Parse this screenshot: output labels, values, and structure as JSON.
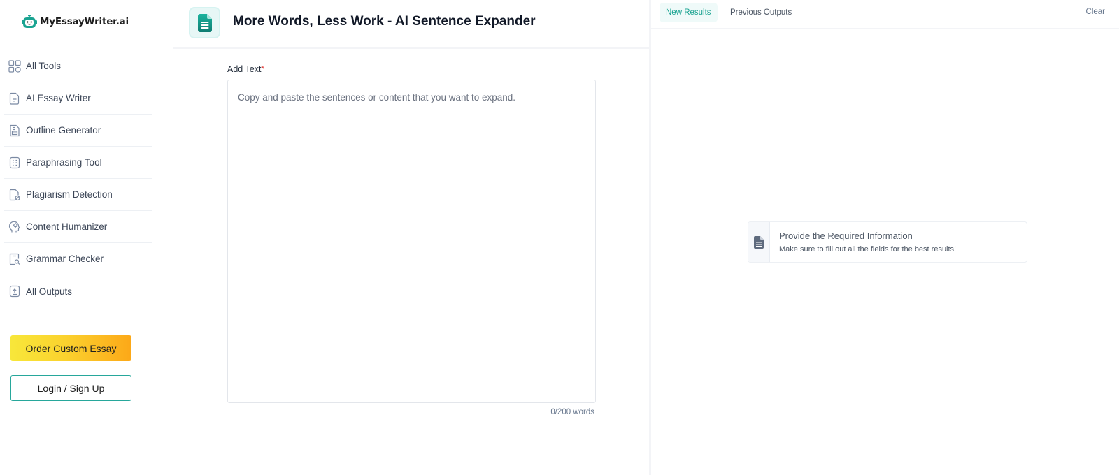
{
  "brand": {
    "name": "MyEssayWriter.ai",
    "accent": "#1aa391"
  },
  "sidebar": {
    "items": [
      {
        "label": "All Tools",
        "icon": "grid-icon"
      },
      {
        "label": "AI Essay Writer",
        "icon": "document-icon"
      },
      {
        "label": "Outline Generator",
        "icon": "outline-icon"
      },
      {
        "label": "Paraphrasing Tool",
        "icon": "paraphrase-icon"
      },
      {
        "label": "Plagiarism Detection",
        "icon": "plagiarism-icon"
      },
      {
        "label": "Content Humanizer",
        "icon": "humanizer-icon"
      },
      {
        "label": "Grammar Checker",
        "icon": "grammar-check-icon"
      },
      {
        "label": "All Outputs",
        "icon": "outputs-icon"
      }
    ],
    "order_button": "Order Custom Essay",
    "login_button": "Login / Sign Up"
  },
  "main": {
    "title": "More Words, Less Work - AI Sentence Expander",
    "field_label": "Add Text",
    "required_mark": "*",
    "input_value": "",
    "input_placeholder": "Copy and paste the sentences or content that you want to expand.",
    "word_count": "0/200 words"
  },
  "results": {
    "tabs": [
      {
        "label": "New Results",
        "active": true
      },
      {
        "label": "Previous Outputs",
        "active": false
      }
    ],
    "clear_label": "Clear",
    "empty_title": "Provide the Required Information",
    "empty_subtitle": "Make sure to fill out all the fields for the best results!"
  }
}
